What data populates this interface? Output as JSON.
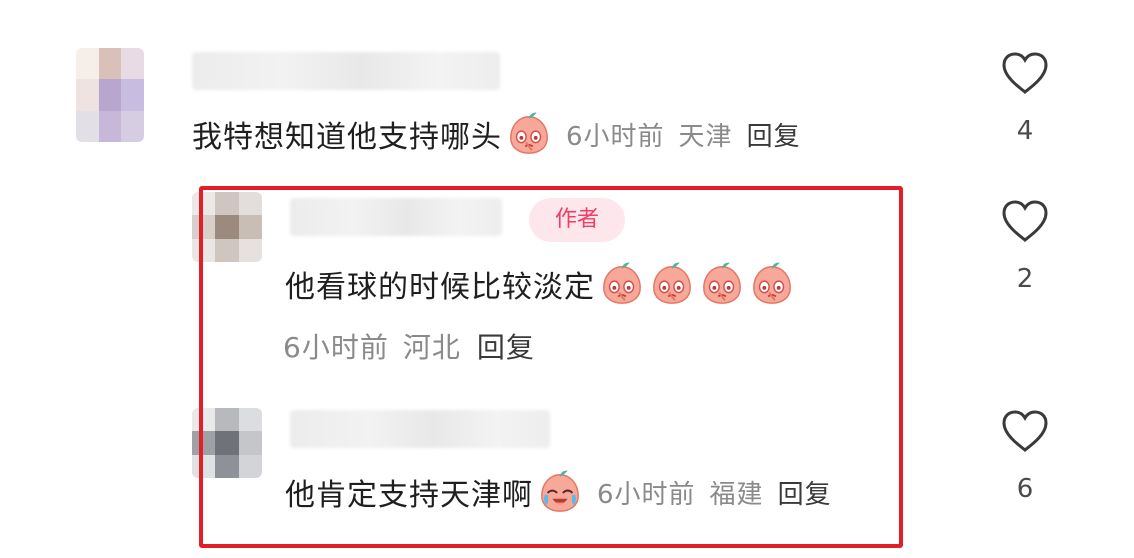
{
  "comments": [
    {
      "text": "我特想知道他支持哪头",
      "time": "6小时前",
      "location": "天津",
      "reply_label": "回复",
      "likes": "4",
      "emojis": [
        "blushing-peach-face"
      ]
    },
    {
      "badge": "作者",
      "text": "他看球的时候比较淡定",
      "time": "6小时前",
      "location": "河北",
      "reply_label": "回复",
      "likes": "2",
      "emojis": [
        "blushing-peach-face",
        "blushing-peach-face",
        "blushing-peach-face",
        "blushing-peach-face"
      ]
    },
    {
      "text": "他肯定支持天津啊",
      "time": "6小时前",
      "location": "福建",
      "reply_label": "回复",
      "likes": "6",
      "emojis": [
        "laughing-crying-peach-face"
      ]
    }
  ],
  "colors": {
    "highlight_frame": "#e21f26",
    "badge_text": "#f03d63",
    "badge_bg": "#fde7ec",
    "meta_text": "#8a8a8a"
  },
  "icons": {
    "like": "heart-outline-icon"
  }
}
